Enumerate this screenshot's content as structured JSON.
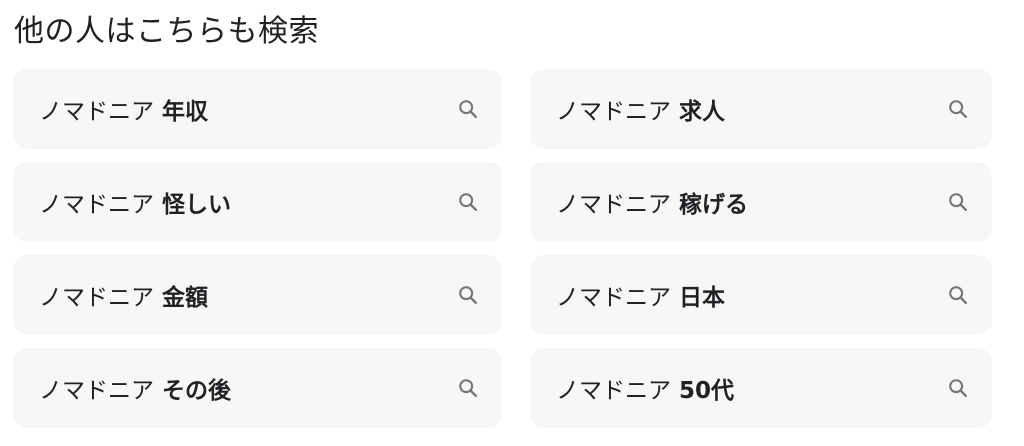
{
  "section": {
    "title": "他の人はこちらも検索"
  },
  "suggestions": [
    {
      "base": "ノマドニア",
      "term": "年収",
      "icon": "search-icon"
    },
    {
      "base": "ノマドニア",
      "term": "求人",
      "icon": "search-icon"
    },
    {
      "base": "ノマドニア",
      "term": "怪しい",
      "icon": "search-icon"
    },
    {
      "base": "ノマドニア",
      "term": "稼げる",
      "icon": "search-icon"
    },
    {
      "base": "ノマドニア",
      "term": "金額",
      "icon": "search-icon"
    },
    {
      "base": "ノマドニア",
      "term": "日本",
      "icon": "search-icon"
    },
    {
      "base": "ノマドニア",
      "term": "その後",
      "icon": "search-icon"
    },
    {
      "base": "ノマドニア",
      "term": "50代",
      "icon": "search-icon"
    }
  ],
  "colors": {
    "chip_background": "#f7f7f7",
    "text": "#202124",
    "icon": "#70757a"
  }
}
